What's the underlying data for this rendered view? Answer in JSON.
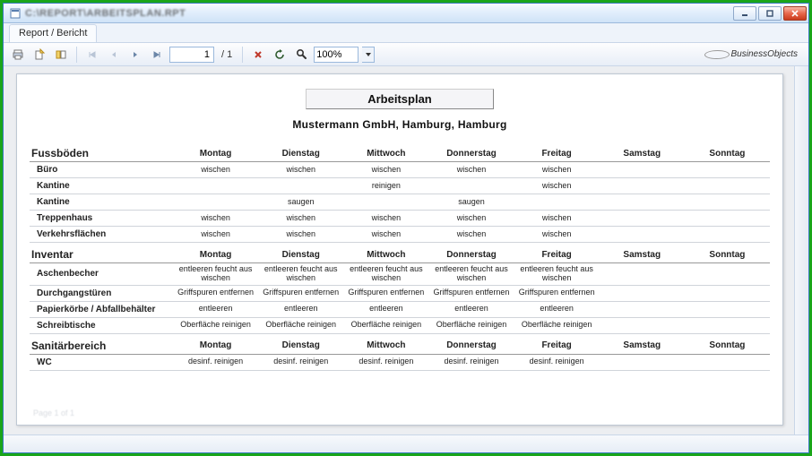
{
  "window": {
    "title": "C:\\REPORT\\ARBEITSPLAN.RPT"
  },
  "tab": {
    "label": "Report / Bericht"
  },
  "toolbar": {
    "page_current": "1",
    "page_total": "/ 1",
    "zoom": "100%"
  },
  "brand": {
    "text": "BusinessObjects"
  },
  "report": {
    "title": "Arbeitsplan",
    "company": "Mustermann GmbH, Hamburg, Hamburg",
    "days": [
      "Montag",
      "Dienstag",
      "Mittwoch",
      "Donnerstag",
      "Freitag",
      "Samstag",
      "Sonntag"
    ],
    "sections": [
      {
        "title": "Fussböden",
        "rows": [
          {
            "label": "Büro",
            "cells": [
              "wischen",
              "wischen",
              "wischen",
              "wischen",
              "wischen",
              "",
              ""
            ]
          },
          {
            "label": "Kantine",
            "cells": [
              "",
              "",
              "reinigen",
              "",
              "wischen",
              "",
              ""
            ]
          },
          {
            "label": "Kantine",
            "cells": [
              "",
              "saugen",
              "",
              "saugen",
              "",
              "",
              ""
            ]
          },
          {
            "label": "Treppenhaus",
            "cells": [
              "wischen",
              "wischen",
              "wischen",
              "wischen",
              "wischen",
              "",
              ""
            ]
          },
          {
            "label": "Verkehrsflächen",
            "cells": [
              "wischen",
              "wischen",
              "wischen",
              "wischen",
              "wischen",
              "",
              ""
            ]
          }
        ]
      },
      {
        "title": "Inventar",
        "rows": [
          {
            "label": "Aschenbecher",
            "cells": [
              "entleeren feucht aus wischen",
              "entleeren feucht aus wischen",
              "entleeren feucht aus wischen",
              "entleeren feucht aus wischen",
              "entleeren feucht aus wischen",
              "",
              ""
            ]
          },
          {
            "label": "Durchgangstüren",
            "cells": [
              "Griffspuren entfernen",
              "Griffspuren entfernen",
              "Griffspuren entfernen",
              "Griffspuren entfernen",
              "Griffspuren entfernen",
              "",
              ""
            ]
          },
          {
            "label": "Papierkörbe / Abfallbehälter",
            "cells": [
              "entleeren",
              "entleeren",
              "entleeren",
              "entleeren",
              "entleeren",
              "",
              ""
            ]
          },
          {
            "label": "Schreibtische",
            "cells": [
              "Oberfläche reinigen",
              "Oberfläche reinigen",
              "Oberfläche reinigen",
              "Oberfläche reinigen",
              "Oberfläche reinigen",
              "",
              ""
            ]
          }
        ]
      },
      {
        "title": "Sanitärbereich",
        "rows": [
          {
            "label": "WC",
            "cells": [
              "desinf. reinigen",
              "desinf. reinigen",
              "desinf. reinigen",
              "desinf. reinigen",
              "desinf. reinigen",
              "",
              ""
            ]
          }
        ]
      }
    ]
  }
}
